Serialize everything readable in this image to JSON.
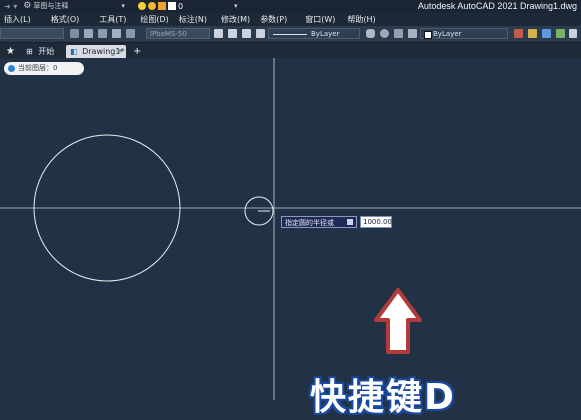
{
  "app": {
    "title": "Autodesk AutoCAD 2021   Drawing1.dwg"
  },
  "quick_access": {
    "workspace": "草图与注释",
    "layer_value": "0"
  },
  "menu": {
    "items": [
      "插入(L)",
      "格式(O)",
      "工具(T)",
      "绘图(D)",
      "标注(N)",
      "修改(M)",
      "参数(P)",
      "窗口(W)",
      "帮助(H)"
    ]
  },
  "toolbar": {
    "plotstyle": "lPboMS-50",
    "linetype": "ByLayer",
    "color": "ByLayer"
  },
  "tabs": {
    "start": "开始",
    "drawing": "Drawing1*"
  },
  "canvas": {
    "layer_badge": "当前图层：0",
    "prompt": "指定圆的半径或",
    "radius_value": "1000.00",
    "overlay_text": "快捷键D"
  },
  "colors": {
    "background": "#213246",
    "crosshair": "#c9d3de",
    "geometry": "#e6ecf2",
    "arrow_fill": "#ffffff",
    "arrow_stroke": "#b23a3a"
  }
}
